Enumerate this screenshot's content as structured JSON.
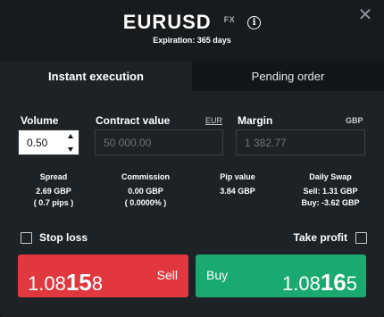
{
  "header": {
    "symbol": "EURUSD",
    "tag": "FX",
    "info_icon": "info-circle-icon",
    "expiration": "Expiration: 365 days",
    "close_icon": "close-x-icon"
  },
  "tabs": [
    {
      "label": "Instant execution",
      "active": true
    },
    {
      "label": "Pending order",
      "active": false
    }
  ],
  "volume": {
    "label": "Volume",
    "value": "0.50"
  },
  "contract_value": {
    "label": "Contract value",
    "currency": "EUR",
    "value": "50 000.00"
  },
  "margin": {
    "label": "Margin",
    "currency": "GBP",
    "value": "1 382.77"
  },
  "stats": {
    "spread": {
      "title": "Spread",
      "line1": "2.69 GBP",
      "line2": "( 0.7 pips )"
    },
    "commission": {
      "title": "Commission",
      "line1": "0.00 GBP",
      "line2": "( 0.0000% )"
    },
    "pip_value": {
      "title": "Pip value",
      "line1": "3.84 GBP"
    },
    "daily_swap": {
      "title": "Daily Swap",
      "line1": "Sell: 1.31 GBP",
      "line2": "Buy: -3.62 GBP"
    }
  },
  "stop_loss": {
    "label": "Stop loss",
    "checked": false
  },
  "take_profit": {
    "label": "Take profit",
    "checked": false
  },
  "sell": {
    "label": "Sell",
    "price_prefix": "1.08",
    "price_big": "15",
    "price_suffix": "8",
    "color": "#e0383e"
  },
  "buy": {
    "label": "Buy",
    "price_prefix": "1.08",
    "price_big": "16",
    "price_suffix": "5",
    "color": "#1aaa6f"
  }
}
